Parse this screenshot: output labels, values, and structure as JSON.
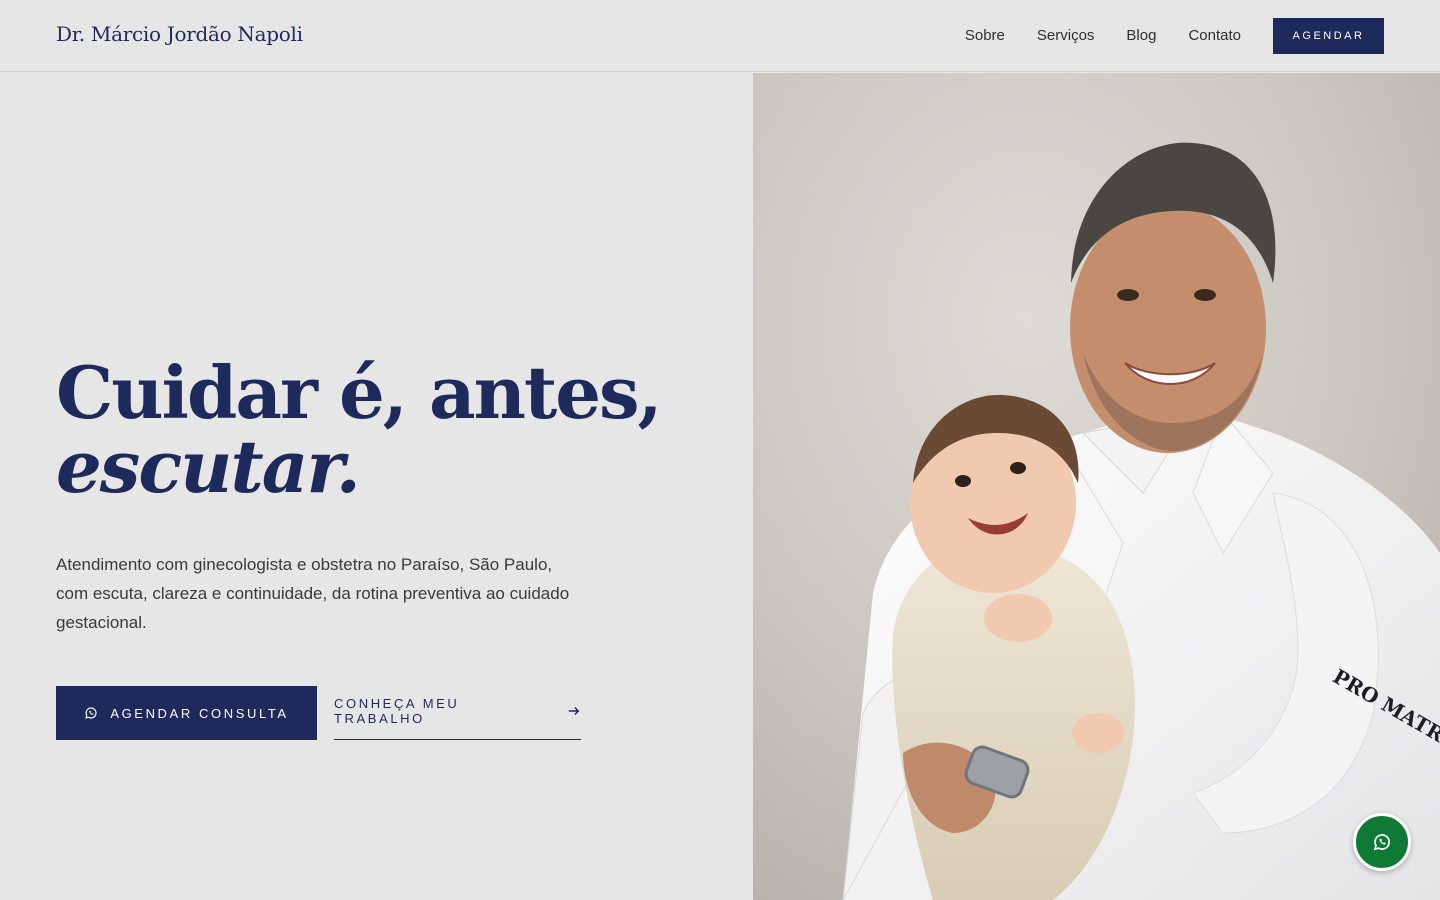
{
  "header": {
    "brand": "Dr. Márcio Jordão Napoli",
    "nav": [
      "Sobre",
      "Serviços",
      "Blog",
      "Contato"
    ],
    "cta_label": "AGENDAR"
  },
  "hero": {
    "title_line1": "Cuidar é, antes,",
    "title_line2": "escutar.",
    "subtitle": "Atendimento com ginecologista e obstetra no Paraíso, São Paulo, com escuta, clareza e continuidade, da rotina preventiva ao cuidado gestacional.",
    "primary_button": "AGENDAR CONSULTA",
    "secondary_button": "CONHEÇA MEU TRABALHO"
  },
  "photo": {
    "coat_logo": "PRO MATRE PAULISTA"
  },
  "floating_button": {
    "icon": "whatsapp-icon"
  },
  "colors": {
    "brand_navy": "#1f2a5c",
    "background": "#e6e6e6",
    "whatsapp_green": "#0f7a35"
  }
}
